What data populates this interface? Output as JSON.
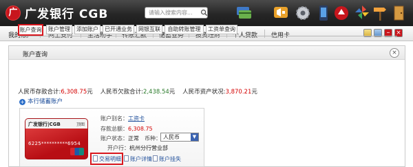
{
  "header": {
    "brand_logo_char": "广",
    "brand_name": "广发银行 CGB",
    "search_placeholder": "请输入搜索内容...",
    "icons": [
      "card-stack-icon",
      "announcement-icon",
      "settings-gear-icon",
      "phone-icon",
      "bank-logo-icon",
      "pinwheel-icon",
      "exit-door-icon"
    ]
  },
  "nav": {
    "items": [
      "我的账户",
      "网上支付",
      "生活助手",
      "转账汇款",
      "储蓄业务",
      "投资理财",
      "个人贷款",
      "信用卡"
    ],
    "window_buttons": [
      "layout-icon",
      "tile-icon",
      "minimize-icon",
      "close-icon"
    ]
  },
  "panel": {
    "title": "账户查询",
    "close": "×",
    "tabs": [
      "账户查询",
      "账户管理",
      "添加账户",
      "已开通业务",
      "网银互联",
      "自助转账管理",
      "工资单查询"
    ],
    "active_tab": 0
  },
  "summary": {
    "deposit_label": "人民币存款合计:",
    "deposit_value": "6,308.75",
    "deposit_unit": "元",
    "debt_label": "人民币欠款合计:",
    "debt_value": "2,438.54",
    "debt_unit": "元",
    "asset_label": "人民币资产状况:",
    "asset_value": "3,870.21",
    "asset_unit": "元"
  },
  "add_account": {
    "label": "本行储蓄账户"
  },
  "account": {
    "card_bank": "广发银行|CGB",
    "card_corner": "顶图",
    "card_number": "6225**********6954",
    "alias_label": "账户别名：",
    "alias_value": "工资卡",
    "balance_label": "存款总额：",
    "balance_value": "6,308.75",
    "status_label": "账户状态：",
    "status_value": "正常",
    "currency_label": "币种：",
    "currency_value": "人民币",
    "branch_label": "开户行：",
    "branch_value": "杭州分行营业部",
    "actions": [
      "交易明细",
      "账户详情",
      "账户挂失"
    ]
  },
  "colors": {
    "brand_red": "#c8161d",
    "amount_red": "#d40000",
    "link_blue": "#1f4f9b",
    "highlight": "#d9161d"
  }
}
